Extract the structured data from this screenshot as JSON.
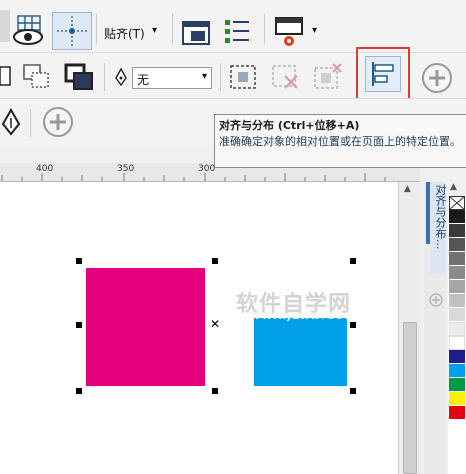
{
  "toolbar1": {
    "snap_label": "贴齐(T)",
    "snap_arrow": "▾"
  },
  "toolbar2": {
    "outline_width_value": "无"
  },
  "tooltip": {
    "title": "对齐与分布 (Ctrl+位移+A)",
    "description": "准确确定对象的相对位置或在页面上的特定位置。"
  },
  "ruler": {
    "ticks": [
      "400",
      "350",
      "300"
    ]
  },
  "docker": {
    "tab_label": "对齐与分布..."
  },
  "watermark": {
    "main": "软件自学网",
    "url": "WWW.RJZXW.COM"
  },
  "shapes": {
    "left_color": "#e6007e",
    "right_color": "#00a0e9"
  },
  "palette": {
    "colors": [
      "#1a1a1a",
      "#3a3a3a",
      "#555555",
      "#707070",
      "#8c8c8c",
      "#a6a6a6",
      "#c0c0c0",
      "#d9d9d9",
      "#ececec",
      "#ffffff",
      "#1d2088",
      "#00a0e9",
      "#009944",
      "#fff100",
      "#e60012"
    ]
  },
  "icons": [
    "eye-icon",
    "grid-icon",
    "snap-icon",
    "window-icon",
    "checklist-icon",
    "laptop-icon",
    "add-icon",
    "align-distribute-icon"
  ]
}
